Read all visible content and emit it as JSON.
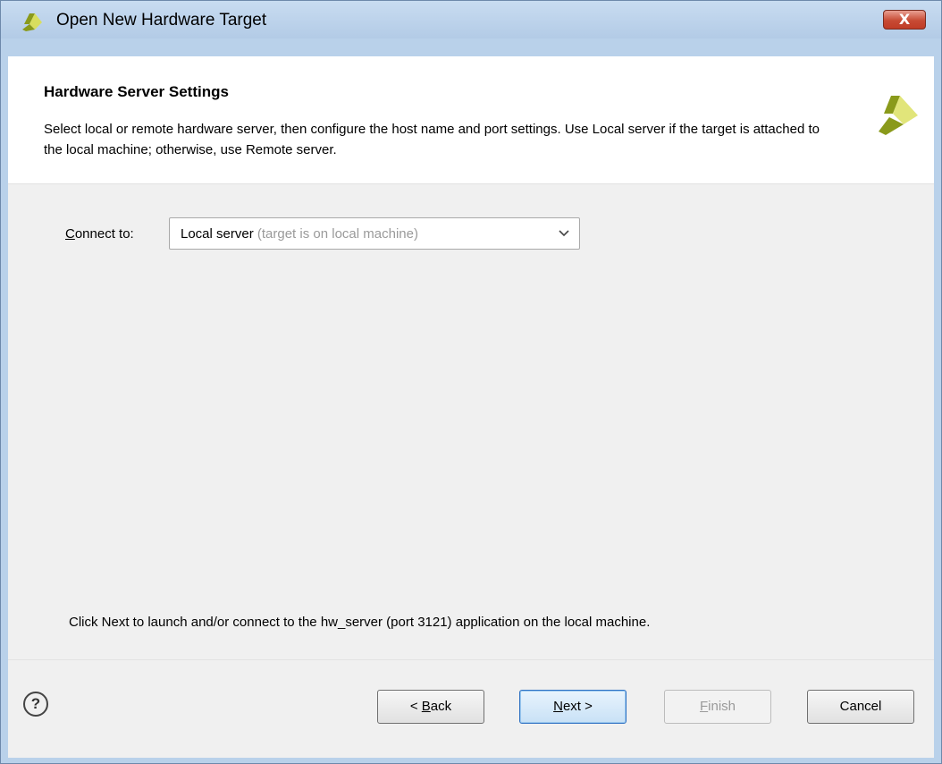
{
  "window": {
    "title": "Open New Hardware Target",
    "close_glyph": "X",
    "logo_icon": "xilinx-logo-icon"
  },
  "header": {
    "title": "Hardware Server Settings",
    "description": "Select local or remote hardware server, then configure the host name and port settings. Use Local server if the target is attached to the local machine; otherwise, use Remote server."
  },
  "connect": {
    "label_mnemonic": "C",
    "label_rest": "onnect to:",
    "selected_value": "Local server",
    "selected_hint": "(target is on local machine)"
  },
  "info": "Click Next to launch and/or connect to the hw_server (port 3121) application on the local machine.",
  "footer": {
    "help_glyph": "?",
    "back": {
      "prefix": "< ",
      "mnemonic": "B",
      "rest": "ack"
    },
    "next": {
      "mnemonic": "N",
      "rest": "ext >"
    },
    "finish": {
      "mnemonic": "F",
      "rest": "inish"
    },
    "cancel": "Cancel"
  },
  "colors": {
    "logo_green": "#8a9a1b",
    "logo_yellow": "#e1e57a",
    "close_red": "#c74a34",
    "title_bar": "#b9d1ea"
  }
}
